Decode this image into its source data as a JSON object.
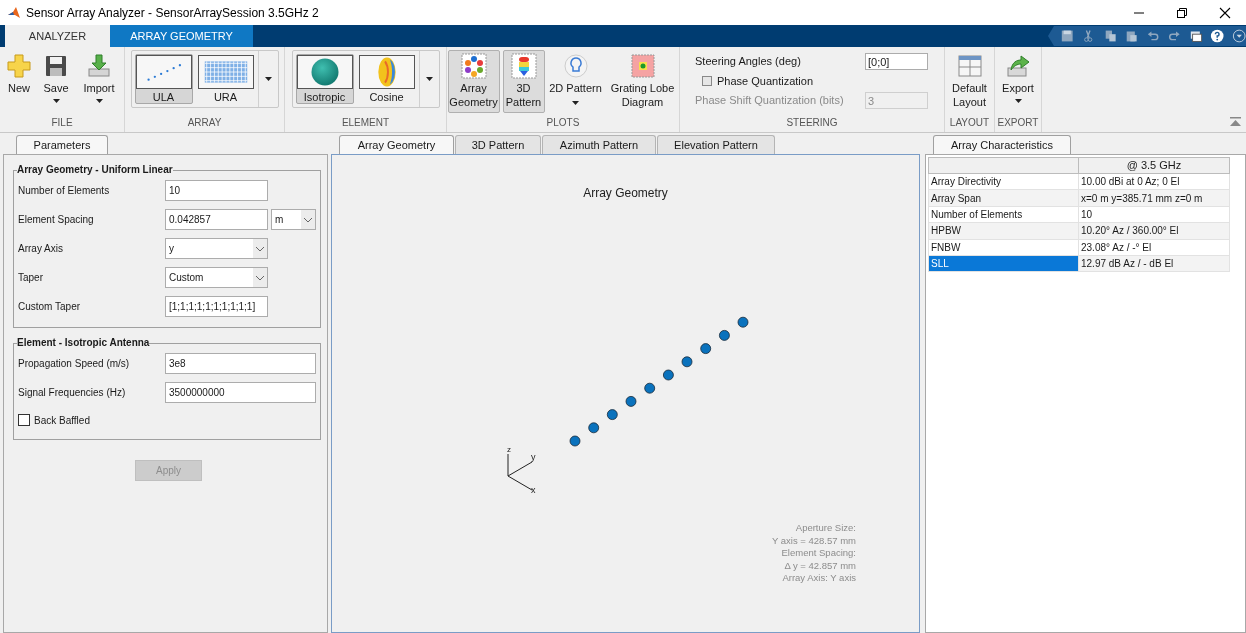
{
  "window": {
    "title": "Sensor Array Analyzer - SensorArraySession 3.5GHz 2"
  },
  "ribbon_tabs": [
    {
      "label": "ANALYZER",
      "selected": true
    },
    {
      "label": "ARRAY GEOMETRY",
      "selected": false
    }
  ],
  "toolstrip": {
    "sections": [
      {
        "kind": "buttons",
        "title": "FILE",
        "buttons": [
          {
            "label": "New",
            "menu": false,
            "selected": false
          },
          {
            "label": "Save",
            "menu": true,
            "selected": false
          },
          {
            "label": "Import",
            "menu": true,
            "selected": false
          }
        ]
      },
      {
        "kind": "gallery",
        "title": "ARRAY",
        "items": [
          {
            "label": "ULA",
            "selected": true
          },
          {
            "label": "URA",
            "selected": false
          }
        ]
      },
      {
        "kind": "gallery",
        "title": "ELEMENT",
        "items": [
          {
            "label": "Isotropic",
            "selected": true
          },
          {
            "label": "Cosine",
            "selected": false
          }
        ]
      },
      {
        "kind": "buttons",
        "title": "PLOTS",
        "buttons": [
          {
            "label": "Array Geometry",
            "menu": false,
            "selected": true
          },
          {
            "label": "3D Pattern",
            "menu": false,
            "selected": true
          },
          {
            "label": "2D Pattern",
            "menu": true,
            "selected": false
          },
          {
            "label": "Grating Lobe Diagram",
            "menu": false,
            "selected": false
          }
        ]
      },
      {
        "kind": "steering",
        "title": "STEERING",
        "steering_angles": {
          "label": "Steering Angles (deg)",
          "value": "[0;0]"
        },
        "phase_quantization": {
          "label": "Phase Quantization",
          "checked": false
        },
        "phase_shift_bits": {
          "label": "Phase Shift Quantization (bits)",
          "value": "3",
          "disabled": true
        }
      },
      {
        "kind": "buttons",
        "title": "LAYOUT",
        "buttons": [
          {
            "label": "Default Layout",
            "menu": false,
            "selected": false
          }
        ]
      },
      {
        "kind": "buttons",
        "title": "EXPORT",
        "buttons": [
          {
            "label": "Export",
            "menu": true,
            "selected": false
          }
        ]
      }
    ]
  },
  "parameters_panel": {
    "tab": "Parameters",
    "groups": [
      {
        "title": "Array Geometry - Uniform Linear",
        "fields": [
          {
            "kind": "text",
            "label": "Number of Elements",
            "value": "10"
          },
          {
            "kind": "text_unit",
            "label": "Element Spacing",
            "value": "0.042857",
            "unit": "m"
          },
          {
            "kind": "select",
            "label": "Array Axis",
            "value": "y"
          },
          {
            "kind": "select",
            "label": "Taper",
            "value": "Custom"
          },
          {
            "kind": "text",
            "label": "Custom Taper",
            "value": "[1;1;1;1;1;1;1;1;1;1]"
          }
        ]
      },
      {
        "title": "Element - Isotropic Antenna",
        "fields": [
          {
            "kind": "text_wide",
            "label": "Propagation Speed (m/s)",
            "value": "3e8"
          },
          {
            "kind": "text_wide",
            "label": "Signal Frequencies (Hz)",
            "value": "3500000000"
          },
          {
            "kind": "checkbox",
            "label": "Back Baffled",
            "checked": false
          }
        ]
      }
    ],
    "apply": {
      "label": "Apply",
      "disabled": true
    }
  },
  "plot_tabs": [
    {
      "label": "Array Geometry",
      "selected": true
    },
    {
      "label": "3D Pattern",
      "selected": false
    },
    {
      "label": "Azimuth Pattern",
      "selected": false
    },
    {
      "label": "Elevation Pattern",
      "selected": false
    }
  ],
  "plot": {
    "title": "Array Geometry",
    "axes": {
      "z_label": "z",
      "y_label": "y",
      "x_label": "x"
    },
    "annotation": [
      "Aperture Size:",
      "Y axis = 428.57 mm",
      "Element Spacing:",
      "Δ y = 42.857 mm",
      "Array Axis: Y axis"
    ]
  },
  "characteristics_panel": {
    "tab": "Array Characteristics",
    "column_header": "@ 3.5 GHz",
    "rows": [
      {
        "name": "Array Directivity",
        "value": "10.00 dBi at 0 Az; 0 El",
        "selected": false
      },
      {
        "name": "Array Span",
        "value": "x=0 m y=385.71 mm z=0 m",
        "selected": false
      },
      {
        "name": "Number of Elements",
        "value": "10",
        "selected": false
      },
      {
        "name": "HPBW",
        "value": "10.20° Az / 360.00° El",
        "selected": false
      },
      {
        "name": "FNBW",
        "value": "23.08° Az / -° El",
        "selected": false
      },
      {
        "name": "SLL",
        "value": "12.97 dB Az / - dB El",
        "selected": true
      }
    ]
  }
}
